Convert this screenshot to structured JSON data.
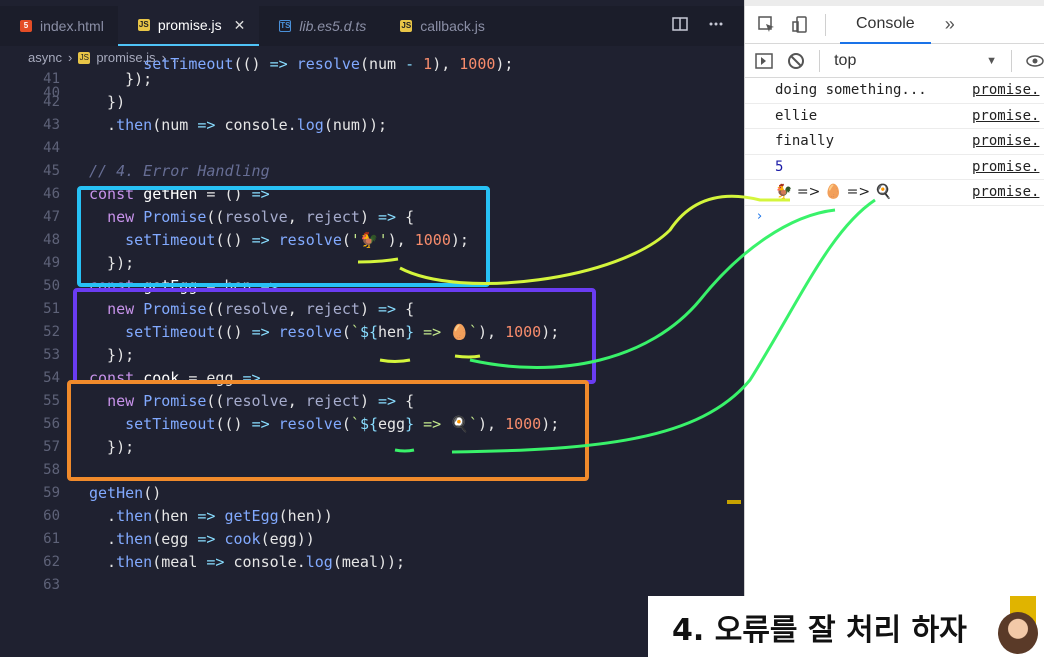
{
  "editor": {
    "tabs": [
      {
        "icon": "html",
        "label": "index.html",
        "active": false
      },
      {
        "icon": "js",
        "label": "promise.js",
        "active": true
      },
      {
        "icon": "ts",
        "label": "lib.es5.d.ts",
        "active": false
      },
      {
        "icon": "js",
        "label": "callback.js",
        "active": false
      }
    ],
    "close_glyph": "✕",
    "breadcrumb": {
      "folder": "async",
      "file": "promise.js",
      "more": "..."
    },
    "file_icons": {
      "html": "5",
      "js": "JS",
      "ts": "TS"
    }
  },
  "code_lines": [
    {
      "n": "40"
    },
    {
      "n": "41"
    },
    {
      "n": "42"
    },
    {
      "n": "43"
    },
    {
      "n": "44"
    },
    {
      "n": "45"
    },
    {
      "n": "46"
    },
    {
      "n": "47"
    },
    {
      "n": "48"
    },
    {
      "n": "49"
    },
    {
      "n": "50"
    },
    {
      "n": "51"
    },
    {
      "n": "52"
    },
    {
      "n": "53"
    },
    {
      "n": "54"
    },
    {
      "n": "55"
    },
    {
      "n": "56"
    },
    {
      "n": "57"
    },
    {
      "n": "58"
    },
    {
      "n": "59"
    },
    {
      "n": "60"
    },
    {
      "n": "61"
    },
    {
      "n": "62"
    },
    {
      "n": "63"
    }
  ],
  "devtools": {
    "tab": "Console",
    "more": "»",
    "context": "top",
    "logs": [
      {
        "msg": "doing something...",
        "src": "promise.",
        "type": "text"
      },
      {
        "msg": "ellie",
        "src": "promise.",
        "type": "text"
      },
      {
        "msg": "finally",
        "src": "promise.",
        "type": "text"
      },
      {
        "msg": "5",
        "src": "promise.",
        "type": "number"
      },
      {
        "msg": "🐓 => 🥚 => 🍳",
        "src": "promise.",
        "type": "text"
      }
    ],
    "prompt": "›"
  },
  "caption": {
    "text": "4. 오류를 잘 처리 하자"
  },
  "colors": {
    "cyan_box": "#27c1f5",
    "purple_box": "#6a3cf2",
    "orange_box": "#f08a2b",
    "highlight": "#d4f53c",
    "arrow": "#39f26a"
  }
}
